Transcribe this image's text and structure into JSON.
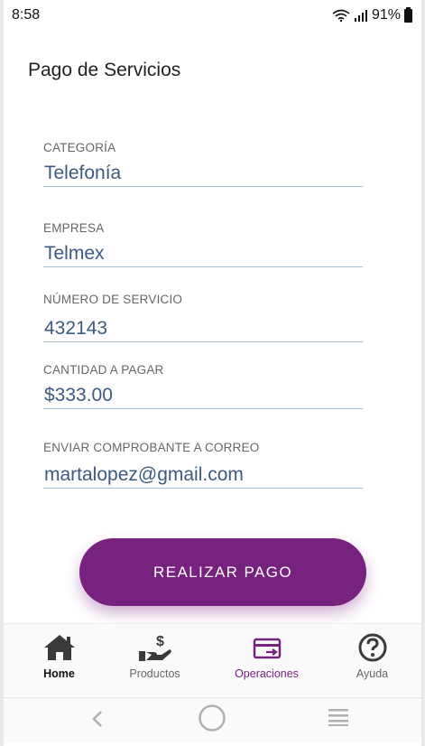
{
  "status": {
    "time": "8:58",
    "battery": "91%"
  },
  "header": {
    "title": "Pago de Servicios"
  },
  "form": {
    "fields": [
      {
        "label": "CATEGORÍA",
        "value": "Telefonía"
      },
      {
        "label": "EMPRESA",
        "value": "Telmex"
      },
      {
        "label": "NÚMERO DE SERVICIO",
        "value": "432143"
      },
      {
        "label": "CANTIDAD A PAGAR",
        "value": "$333.00"
      },
      {
        "label": "ENVIAR COMPROBANTE A CORREO",
        "value": "martalopez@gmail.com"
      }
    ],
    "submit_label": "REALIZAR PAGO"
  },
  "bottom_nav": {
    "items": [
      {
        "label": "Home",
        "icon": "home-icon"
      },
      {
        "label": "Productos",
        "icon": "hand-dollar-icon"
      },
      {
        "label": "Operaciones",
        "icon": "card-transfer-icon"
      },
      {
        "label": "Ayuda",
        "icon": "help-icon"
      }
    ],
    "active": "Operaciones"
  },
  "colors": {
    "primary": "#77227f",
    "value_text": "#3d5a80",
    "underline": "#a9bdd0"
  }
}
